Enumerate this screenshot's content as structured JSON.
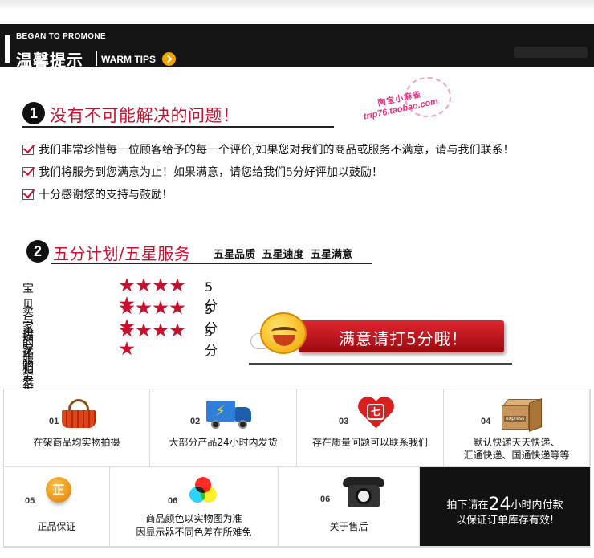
{
  "header": {
    "en_title": "BEGAN TO PROMONE",
    "cn_title": "温馨提示",
    "warm_label": "WARM TIPS"
  },
  "section1": {
    "number": "1",
    "title": "没有不可能解决的问题！",
    "stamp_name": "陶宝小麻雀",
    "stamp_url": "trip76.taobao.com",
    "tips": [
      "我们非常珍惜每一位顾客给予的每一个评价,如果您对我们的商品或服务不满意，请与我们联系！",
      "我们将服务到您满意为止！如果满意，请您给我们5分好评加以鼓励！",
      "十分感谢您的支持与鼓励!"
    ]
  },
  "section2": {
    "number": "2",
    "title": "五分计划/五星服务",
    "subtitle": "五星品质  五星速度  五星满意",
    "ratings": [
      {
        "label": "宝贝与描述相符",
        "stars": 5,
        "score": "5分"
      },
      {
        "label": "卖家的服务态度",
        "stars": 5,
        "score": "5分"
      },
      {
        "label": "卖家的发货速度",
        "stars": 5,
        "score": "5分"
      }
    ],
    "banner_text": "满意请打5分哦！"
  },
  "services": [
    {
      "num": "01",
      "text": "在架商品均实物拍摄",
      "icon": "basket-icon"
    },
    {
      "num": "02",
      "text": "大部分产品24小时内发货",
      "icon": "truck-icon"
    },
    {
      "num": "03",
      "text": "存在质量问题可以联系我们",
      "icon": "heart-icon"
    },
    {
      "num": "04",
      "text": "默认快递天天快递、",
      "text2": "汇通快递、国通快递等等",
      "icon": "parcel-icon",
      "box_label": "express"
    },
    {
      "num": "05",
      "text": "正品保证",
      "icon": "genuine-icon",
      "glyph": "正"
    },
    {
      "num": "06",
      "text": "商品颜色以实物图为准",
      "text2": "因显示器不同色差在所难免",
      "icon": "color-wheel-icon"
    },
    {
      "num": "06",
      "text": "关于售后",
      "icon": "phone-icon"
    }
  ],
  "notice": {
    "line1_pre": "拍下请在",
    "line1_big": "24",
    "line1_post": "小时内付款",
    "line2": "以保证订单库存有效!"
  },
  "colors": {
    "accent_red": "#c8102e",
    "header_bg": "#141414",
    "arrow_orange": "#f0a400",
    "notice_bg": "#121212"
  }
}
